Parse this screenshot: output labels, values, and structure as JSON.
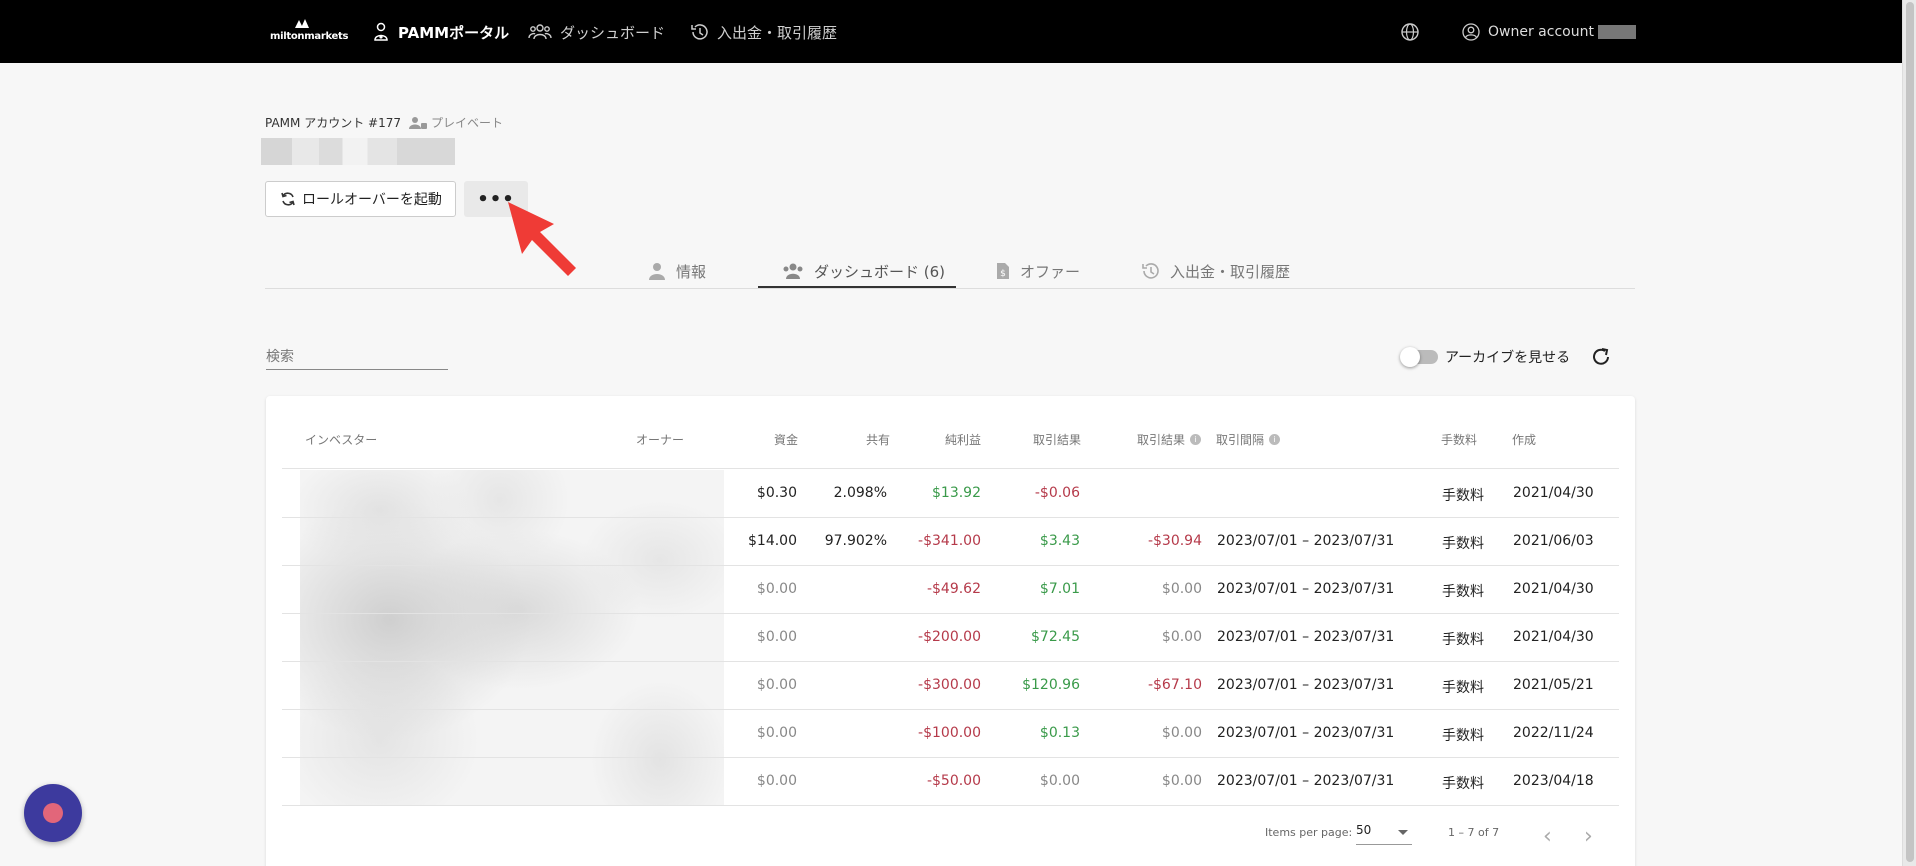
{
  "header": {
    "logo": "miltonmarkets",
    "nav": [
      {
        "label": "PAMMポータル",
        "icon": "pamm-portal-icon"
      },
      {
        "label": "ダッシュボード",
        "icon": "users-icon"
      },
      {
        "label": "入出金・取引履歴",
        "icon": "history-icon"
      }
    ],
    "owner_label": "Owner account"
  },
  "account": {
    "title": "PAMM アカウント #177",
    "privacy": "プレイベート",
    "rollover_button": "ロールオーバーを起動",
    "more_button": "•••"
  },
  "tabs": [
    {
      "label": "情報"
    },
    {
      "label": "ダッシュボード (6)"
    },
    {
      "label": "オファー"
    },
    {
      "label": "入出金・取引履歴"
    }
  ],
  "search": {
    "placeholder": "検索"
  },
  "archive_toggle_label": "アーカイブを見せる",
  "table": {
    "headers": {
      "investor": "インベスター",
      "owner": "オーナー",
      "funds": "資金",
      "share": "共有",
      "net_profit": "純利益",
      "trade_result": "取引結果",
      "trade_result2": "取引結果",
      "trade_period": "取引間隔",
      "fee": "手数料",
      "created": "作成"
    },
    "rows": [
      {
        "funds": "$0.30",
        "share": "2.098%",
        "net": "$13.92",
        "result": "-$0.06",
        "result2": "",
        "period": "",
        "fee": "手数料",
        "created": "2021/04/30"
      },
      {
        "funds": "$14.00",
        "share": "97.902%",
        "net": "-$341.00",
        "result": "$3.43",
        "result2": "-$30.94",
        "period": "2023/07/01 – 2023/07/31",
        "fee": "手数料",
        "created": "2021/06/03"
      },
      {
        "funds": "$0.00",
        "share": "",
        "net": "-$49.62",
        "result": "$7.01",
        "result2": "$0.00",
        "period": "2023/07/01 – 2023/07/31",
        "fee": "手数料",
        "created": "2021/04/30"
      },
      {
        "funds": "$0.00",
        "share": "",
        "net": "-$200.00",
        "result": "$72.45",
        "result2": "$0.00",
        "period": "2023/07/01 – 2023/07/31",
        "fee": "手数料",
        "created": "2021/04/30"
      },
      {
        "funds": "$0.00",
        "share": "",
        "net": "-$300.00",
        "result": "$120.96",
        "result2": "-$67.10",
        "period": "2023/07/01 – 2023/07/31",
        "fee": "手数料",
        "created": "2021/05/21"
      },
      {
        "funds": "$0.00",
        "share": "",
        "net": "-$100.00",
        "result": "$0.13",
        "result2": "$0.00",
        "period": "2023/07/01 – 2023/07/31",
        "fee": "手数料",
        "created": "2022/11/24"
      },
      {
        "funds": "$0.00",
        "share": "",
        "net": "-$50.00",
        "result": "$0.00",
        "result2": "$0.00",
        "period": "2023/07/01 – 2023/07/31",
        "fee": "手数料",
        "created": "2023/04/18"
      }
    ]
  },
  "paginator": {
    "items_per_page_label": "Items per page:",
    "items_per_page": "50",
    "range": "1 – 7 of 7"
  },
  "colors": {
    "positive": "#3a9a4a",
    "negative": "#b53a4a",
    "muted": "#888888",
    "annotation_arrow": "#ef3b36"
  }
}
